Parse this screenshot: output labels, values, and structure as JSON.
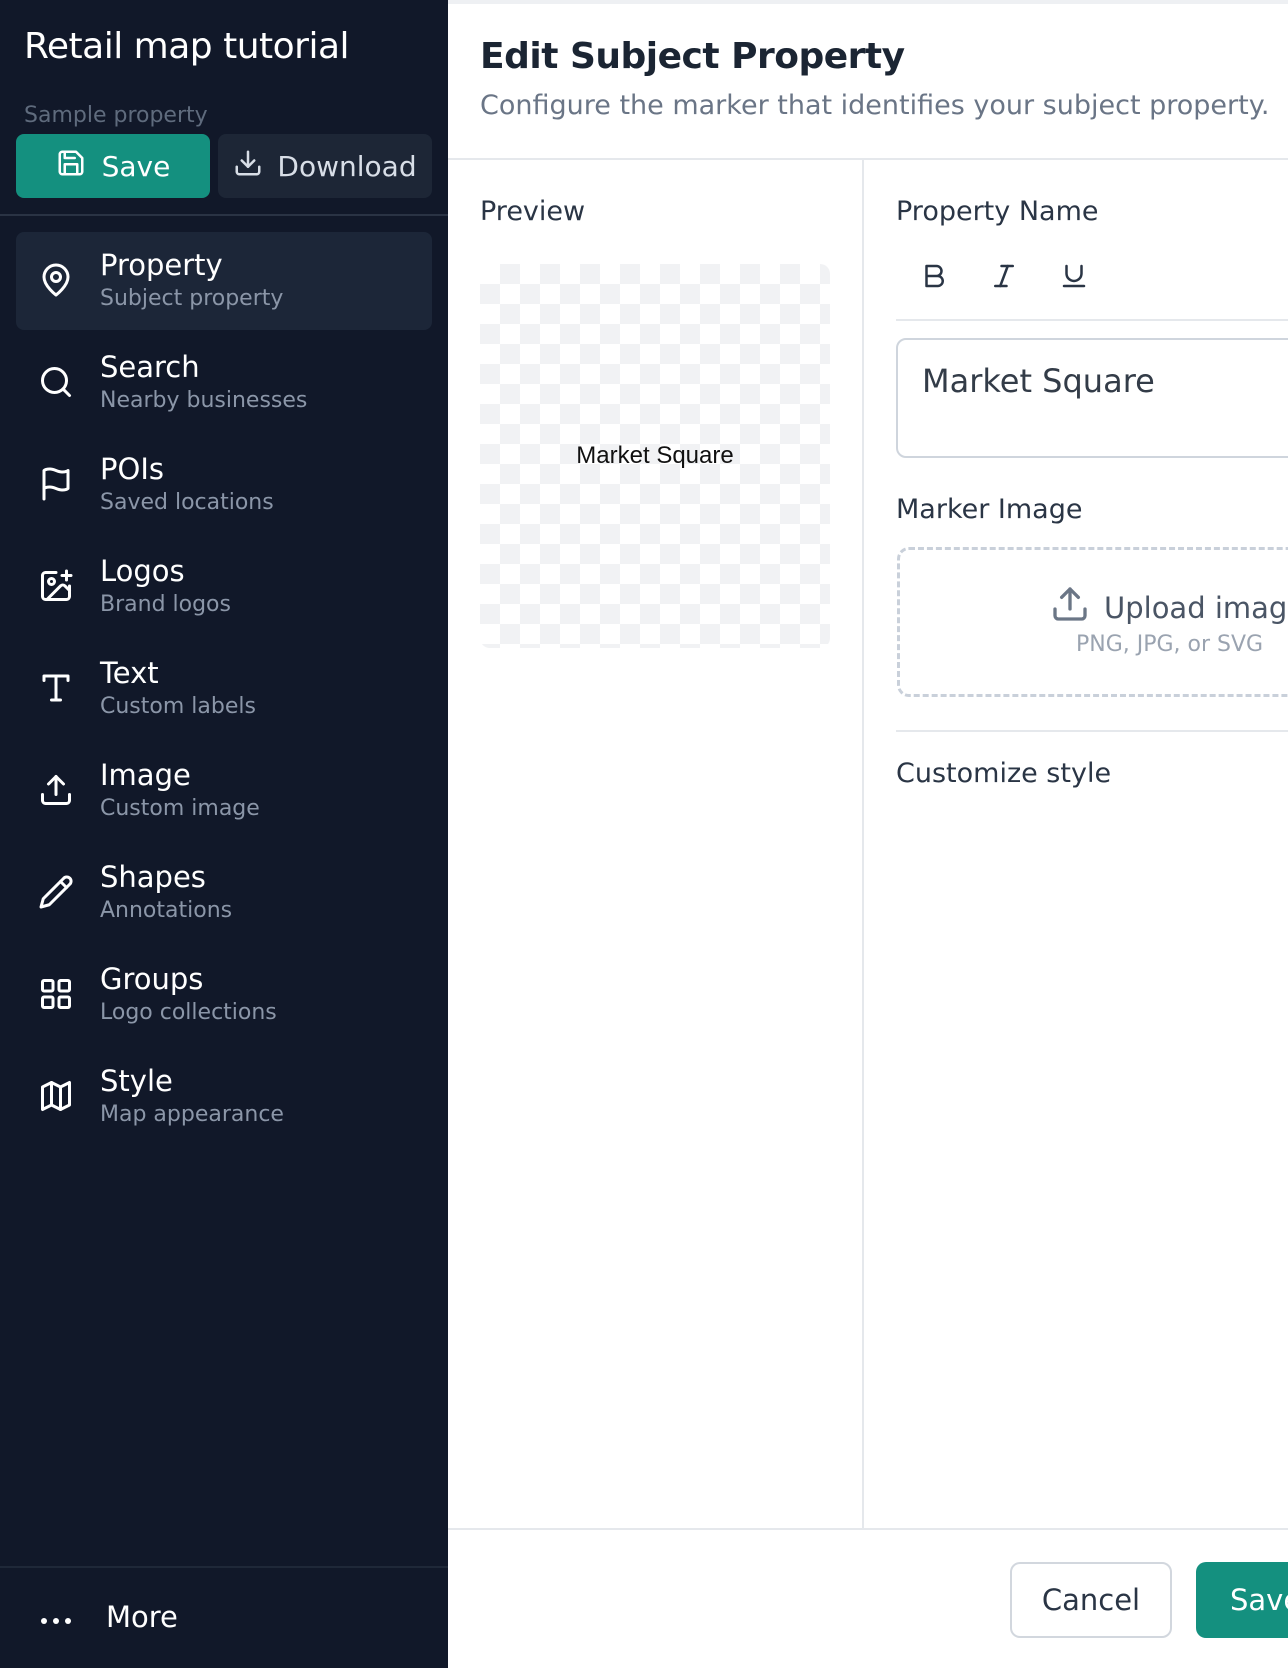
{
  "sidebar": {
    "title": "Retail map tutorial",
    "project_label": "Sample property",
    "save_label": "Save",
    "download_label": "Download",
    "items": [
      {
        "label": "Property",
        "sub": "Subject property",
        "icon": "map-pin-icon"
      },
      {
        "label": "Search",
        "sub": "Nearby businesses",
        "icon": "search-icon"
      },
      {
        "label": "POIs",
        "sub": "Saved locations",
        "icon": "flag-icon"
      },
      {
        "label": "Logos",
        "sub": "Brand logos",
        "icon": "image-plus-icon"
      },
      {
        "label": "Text",
        "sub": "Custom labels",
        "icon": "type-icon"
      },
      {
        "label": "Image",
        "sub": "Custom image",
        "icon": "upload-icon"
      },
      {
        "label": "Shapes",
        "sub": "Annotations",
        "icon": "pencil-icon"
      },
      {
        "label": "Groups",
        "sub": "Logo collections",
        "icon": "grid-icon"
      },
      {
        "label": "Style",
        "sub": "Map appearance",
        "icon": "map-icon"
      }
    ],
    "active_item": "Property",
    "more_label": "More"
  },
  "editor": {
    "title": "Edit Subject Property",
    "subtitle": "Configure the marker that identifies your subject property.",
    "preview_label": "Preview",
    "preview_text": "Market Square",
    "property_name_label": "Property Name",
    "property_name_value": "Market Square",
    "marker_image_label": "Marker Image",
    "upload_label": "Upload image",
    "upload_hint": "PNG, JPG, or SVG",
    "customize_label": "Customize style",
    "cancel_label": "Cancel",
    "save_label": "Save"
  },
  "colors": {
    "sidebar_bg": "#111829",
    "accent": "#14907f",
    "active_item_bg": "#1c2638"
  }
}
